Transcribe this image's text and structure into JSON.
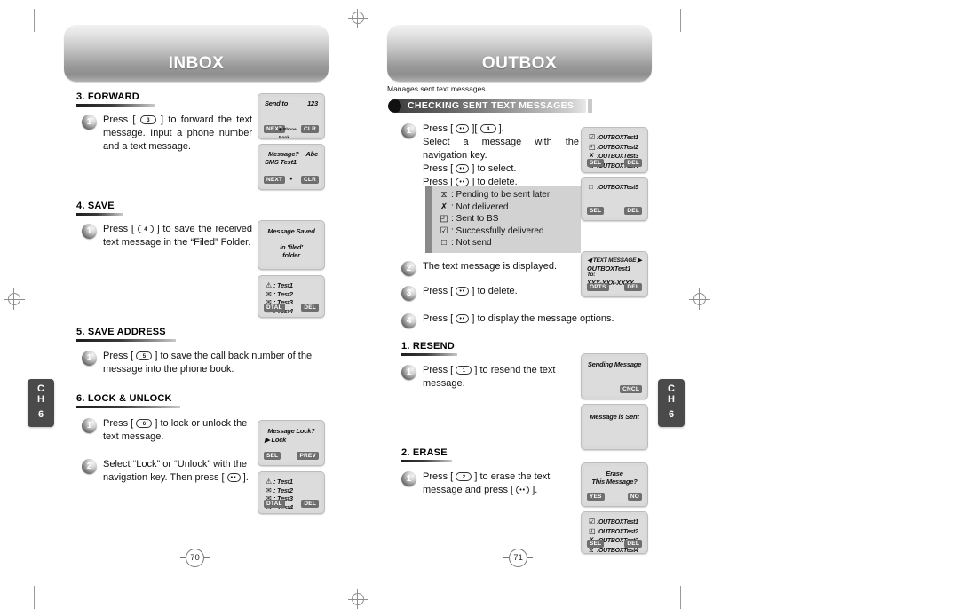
{
  "document": {
    "chapter_tab": {
      "line1": "C",
      "line2": "H",
      "line3": "6"
    }
  },
  "left_page": {
    "header_title": "INBOX",
    "page_number": "70",
    "sections": [
      {
        "heading": "3. FORWARD",
        "steps": [
          {
            "num": "1",
            "text_before_key": "Press [",
            "key": "3",
            "text_after_key": "] to forward the text message. Input a phone number and a text message."
          }
        ]
      },
      {
        "heading": "4. SAVE",
        "steps": [
          {
            "num": "1",
            "text_before_key": "Press [",
            "key": "4",
            "text_after_key": "] to save the received text message in the “Filed” Folder."
          }
        ]
      },
      {
        "heading": "5. SAVE ADDRESS",
        "steps": [
          {
            "num": "1",
            "text_before_key": "Press [",
            "key": "5",
            "text_after_key": "] to save the call back number of the message into the phone book."
          }
        ]
      },
      {
        "heading": "6. LOCK & UNLOCK",
        "steps": [
          {
            "num": "1",
            "text_before_key": "Press [",
            "key": "6",
            "text_after_key": "] to lock or unlock the text message."
          },
          {
            "num": "2",
            "text_before_key": "Select “Lock” or “Unlock” with the navigation key. Then press [",
            "key": "OK",
            "text_after_key": "]."
          }
        ]
      }
    ],
    "screens": {
      "send_to": {
        "title": "Send to",
        "indicator": "123",
        "softkey_left": "NEXT",
        "softkey_mid": "Phone Book",
        "softkey_right": "CLR"
      },
      "message_prompt": {
        "title": "Message?",
        "indicator": "Abc",
        "body": "SMS Test1",
        "softkey_left": "NEXT",
        "softkey_mid": "♦",
        "softkey_right": "CLR"
      },
      "message_saved": {
        "line1": "Message Saved",
        "line2": "in 'filed'",
        "line3": "folder"
      },
      "inbox_list": {
        "items": [
          {
            "glyph": "⚠",
            "label": ": Test1"
          },
          {
            "glyph": "✉",
            "label": ": Test2"
          },
          {
            "glyph": "✉",
            "label": ": Test3"
          },
          {
            "glyph": "✉",
            "label": ": Test4"
          }
        ],
        "softkey_left": "DTAL",
        "softkey_right": "DEL"
      },
      "message_lock": {
        "title": "Message Lock?",
        "option": "▶ Lock",
        "softkey_left": "SEL",
        "softkey_right": "PREV"
      },
      "inbox_list2": {
        "items": [
          {
            "glyph": "⚠",
            "label": ": Test1"
          },
          {
            "glyph": "✉",
            "label": ": Test2"
          },
          {
            "glyph": "✉",
            "label": ": Test3"
          },
          {
            "glyph": "✉",
            "label": ": Test4"
          }
        ],
        "softkey_left": "DTAL",
        "softkey_right": "DEL"
      }
    }
  },
  "right_page": {
    "header_title": "OUTBOX",
    "page_number": "71",
    "intro": "Manages sent text messages.",
    "topic_banner": "CHECKING SENT TEXT MESSAGES",
    "main_steps": [
      {
        "num": "1",
        "lines": [
          {
            "before": "Press [",
            "key1": "OK",
            "between": "][",
            "key2": "4",
            "after": "]."
          },
          {
            "plain": "Select a message with the"
          },
          {
            "plain": "navigation key."
          },
          {
            "before": "Press [",
            "key1": "OK",
            "after": "] to select."
          },
          {
            "before": "Press [",
            "key1": "CLR",
            "after": "] to delete."
          }
        ]
      },
      {
        "num": "2",
        "text": "The text message is displayed."
      },
      {
        "num": "3",
        "before": "Press [",
        "key": "CLR",
        "after": "] to delete."
      },
      {
        "num": "4",
        "before": "Press [",
        "key": "OK",
        "after": "] to display the message options."
      }
    ],
    "legend": [
      {
        "glyph": "⧖",
        "text": ": Pending to be sent later"
      },
      {
        "glyph": "✗",
        "text": ": Not delivered"
      },
      {
        "glyph": "◰",
        "text": ": Sent to BS"
      },
      {
        "glyph": "☑",
        "text": ": Successfully delivered"
      },
      {
        "glyph": "□",
        "text": ": Not send"
      }
    ],
    "sections": [
      {
        "heading": "1. RESEND",
        "steps": [
          {
            "num": "1",
            "text_before_key": "Press [",
            "key": "1",
            "text_after_key": "] to resend the text message."
          }
        ]
      },
      {
        "heading": "2. ERASE",
        "steps": [
          {
            "num": "1",
            "text_before_key": "Press [",
            "key": "2",
            "text_after_key": "] to erase the text message and press [",
            "key2": "OK",
            "text_end": "]."
          }
        ]
      }
    ],
    "screens": {
      "outbox_list": {
        "items": [
          {
            "glyph": "☑",
            "label": ":OUTBOXTest1"
          },
          {
            "glyph": "◰",
            "label": ":OUTBOXTest2"
          },
          {
            "glyph": "✗",
            "label": ":OUTBOXTest3"
          },
          {
            "glyph": "⧖",
            "label": ":OUTBOXTest4"
          }
        ],
        "softkey_left": "SEL",
        "softkey_right": "DEL"
      },
      "outbox_list_single": {
        "items": [
          {
            "glyph": "□",
            "label": ":OUTBOXTest5"
          }
        ],
        "softkey_left": "SEL",
        "softkey_right": "DEL"
      },
      "text_message_view": {
        "title": "◀ TEXT MESSAGE ▶",
        "line1": "OUTBOXTest1",
        "line2": "To:",
        "line3": "XXX-XXX-XXXX",
        "softkey_left": "OPTS",
        "softkey_right": "DEL"
      },
      "sending_message": {
        "title": "Sending Message",
        "softkey_right": "CNCL"
      },
      "message_is_sent": {
        "title": "Message is Sent"
      },
      "erase_confirm": {
        "line1": "Erase",
        "line2": "This Message?",
        "softkey_left": "YES",
        "softkey_right": "NO"
      },
      "outbox_list2": {
        "items": [
          {
            "glyph": "☑",
            "label": ":OUTBOXTest1"
          },
          {
            "glyph": "◰",
            "label": ":OUTBOXTest2"
          },
          {
            "glyph": "✗",
            "label": ":OUTBOXTest3"
          },
          {
            "glyph": "⧖",
            "label": ":OUTBOXTest4"
          }
        ],
        "softkey_left": "SEL",
        "softkey_right": "DEL"
      }
    }
  }
}
